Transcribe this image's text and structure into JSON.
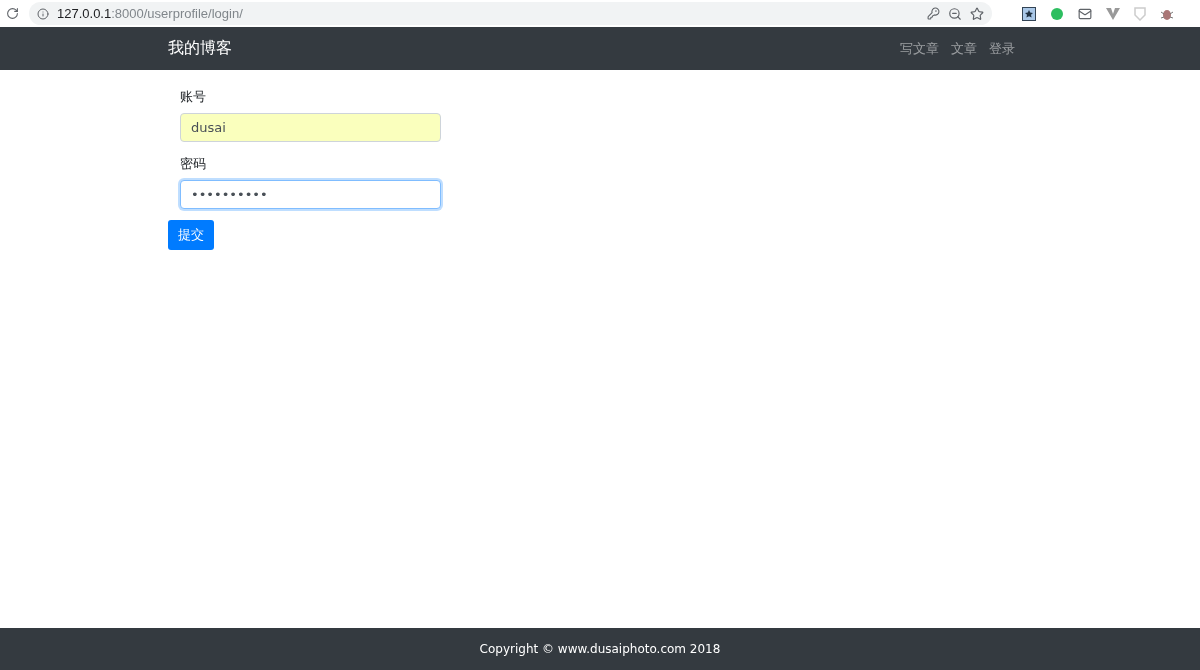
{
  "browser": {
    "url_host": "127.0.0.1",
    "url_path": ":8000/userprofile/login/"
  },
  "navbar": {
    "brand": "我的博客",
    "links": [
      "写文章",
      "文章",
      "登录"
    ]
  },
  "form": {
    "fields": [
      {
        "label": "账号",
        "value": "dusai",
        "autofilled": true,
        "focused": false
      },
      {
        "label": "密码",
        "value": "••••••••••",
        "autofilled": false,
        "focused": true
      }
    ],
    "submit": "提交"
  },
  "footer": {
    "text": "Copyright © www.dusaiphoto.com 2018"
  }
}
